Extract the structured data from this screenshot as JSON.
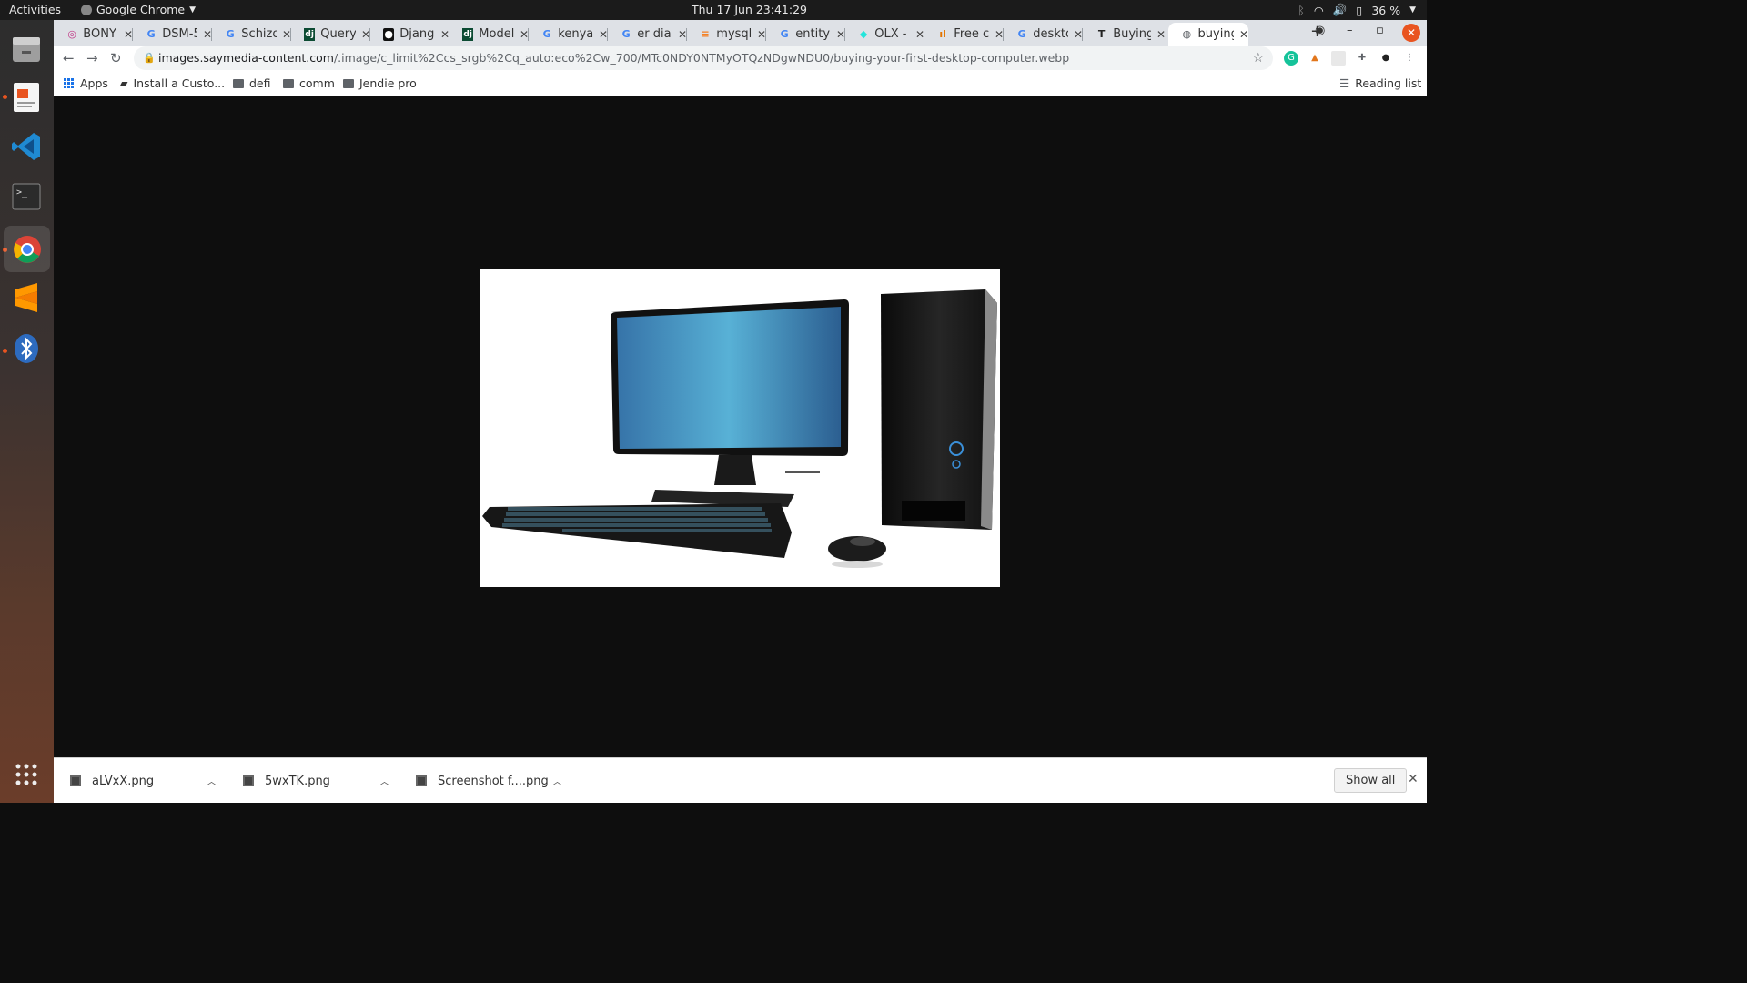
{
  "system": {
    "activities": "Activities",
    "app_name": "Google Chrome",
    "clock": "Thu 17 Jun  23:41:29",
    "battery": "36 %"
  },
  "dock": {
    "items": [
      "files-icon",
      "text-editor-icon",
      "vscode-icon",
      "terminal-icon",
      "chrome-icon",
      "sublime-text-icon",
      "bluetooth-icon",
      "show-apps-icon"
    ]
  },
  "tabs": [
    {
      "label": "BONY",
      "icon": "instagram-icon"
    },
    {
      "label": "DSM-5",
      "icon": "google-icon"
    },
    {
      "label": "Schizo",
      "icon": "google-icon"
    },
    {
      "label": "Query",
      "icon": "django-icon"
    },
    {
      "label": "Djang",
      "icon": "github-icon"
    },
    {
      "label": "Model",
      "icon": "django-icon"
    },
    {
      "label": "kenyar",
      "icon": "google-icon"
    },
    {
      "label": "er diag",
      "icon": "google-icon"
    },
    {
      "label": "mysql",
      "icon": "stackoverflow-icon"
    },
    {
      "label": "entity",
      "icon": "google-icon"
    },
    {
      "label": "OLX -",
      "icon": "olx-icon"
    },
    {
      "label": "Free c",
      "icon": "chart-icon"
    },
    {
      "label": "deskto",
      "icon": "google-icon"
    },
    {
      "label": "Buying",
      "icon": "text-icon"
    },
    {
      "label": "buying",
      "icon": "globe-icon"
    }
  ],
  "address_bar": {
    "host": "images.saymedia-content.com",
    "path": "/.image/c_limit%2Ccs_srgb%2Cq_auto:eco%2Cw_700/MTc0NDY0NTMyOTQzNDgwNDU0/buying-your-first-desktop-computer.webp"
  },
  "bookmarks": {
    "apps": "Apps",
    "items": [
      "Install a Custo...",
      "defi",
      "comm",
      "Jendie pro"
    ],
    "reading_list": "Reading list"
  },
  "downloads": {
    "items": [
      "aLVxX.png",
      "5wxTK.png",
      "Screenshot f....png"
    ],
    "show_all": "Show all"
  },
  "colors": {
    "page_bg": "#0e0e0e",
    "tab_strip": "#dee1e6",
    "ubuntu_orange": "#e95420",
    "monitor_screen": "#4a9bc9"
  }
}
